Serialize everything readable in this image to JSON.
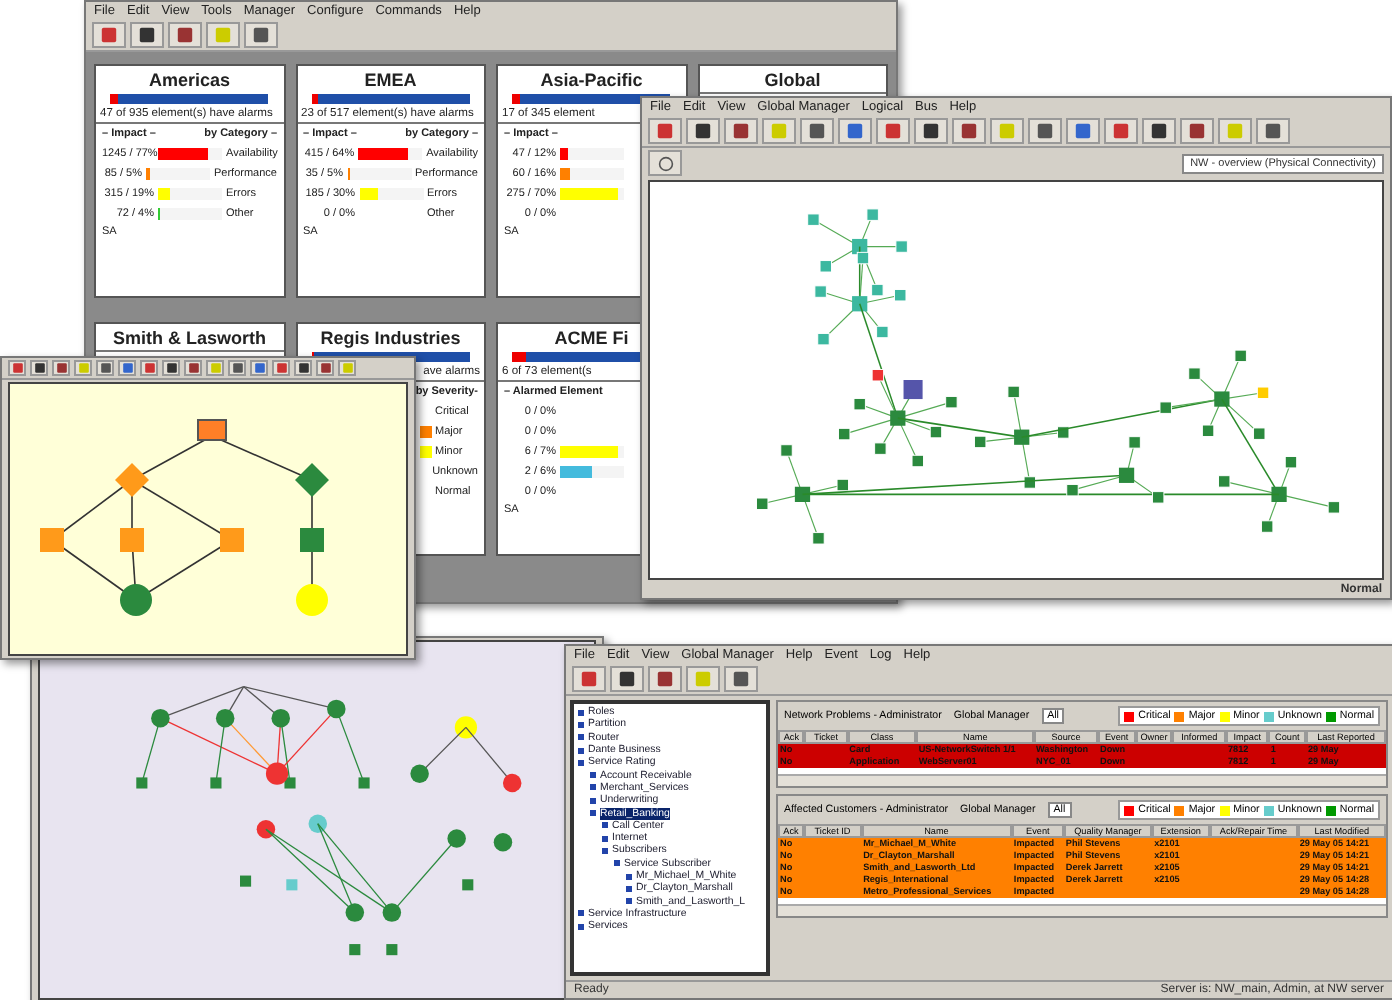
{
  "dashboard_window": {
    "menu": [
      "File",
      "Edit",
      "View",
      "Tools",
      "Manager",
      "Configure",
      "Commands",
      "Help"
    ],
    "cards": [
      {
        "title": "Americas",
        "alarm_bar": {
          "level": 0.05
        },
        "alarm_text": "47 of 935 element(s) have alarms",
        "headers": [
          "– Impact –",
          "by Category –"
        ],
        "rows": [
          {
            "value": "1245 / 77%",
            "level": 0.77,
            "color": "#ff0000",
            "label": "Availability"
          },
          {
            "value": "85 / 5%",
            "level": 0.05,
            "color": "#ff8000",
            "label": "Performance"
          },
          {
            "value": "315 / 19%",
            "level": 0.19,
            "color": "#ffff00",
            "label": "Errors"
          },
          {
            "value": "72 / 4%",
            "level": 0.04,
            "color": "#33cc33",
            "label": "Other"
          }
        ],
        "footer": "SA"
      },
      {
        "title": "EMEA",
        "alarm_bar": {
          "level": 0.04
        },
        "alarm_text": "23 of 517 element(s) have alarms",
        "headers": [
          "– Impact –",
          "by Category –"
        ],
        "rows": [
          {
            "value": "415 / 64%",
            "level": 0.77,
            "color": "#ff0000",
            "label": "Availability"
          },
          {
            "value": "35 / 5%",
            "level": 0.05,
            "color": "#ff8000",
            "label": "Performance"
          },
          {
            "value": "185 / 30%",
            "level": 0.3,
            "color": "#ffff00",
            "label": "Errors"
          },
          {
            "value": "0 / 0%",
            "label": "Other"
          }
        ],
        "footer": "SA"
      },
      {
        "title": "Asia-Pacific",
        "alarm_bar": {
          "level": 0.05
        },
        "alarm_text": "17 of 345 element",
        "headers": [
          "– Impact –"
        ],
        "rows": [
          {
            "value": "47 / 12%",
            "level": 0.12,
            "color": "#ff0000"
          },
          {
            "value": "60 / 16%",
            "level": 0.16,
            "color": "#ff8000"
          },
          {
            "value": "275 / 70%",
            "level": 0.9,
            "color": "#ffff00"
          },
          {
            "value": "0 / 0%"
          }
        ],
        "footer": "SA"
      },
      {
        "title": "Global"
      },
      {
        "title": "Smith & Lasworth"
      },
      {
        "title": "Regis Industries",
        "alarm_bar": {
          "level": 0
        },
        "alarm_text": "ave alarms",
        "headers": [
          "by Severity-"
        ],
        "rows": [
          {
            "label": "Critical"
          },
          {
            "label": "Major",
            "color": "#ff8000"
          },
          {
            "label": "Minor",
            "color": "#ffff00"
          },
          {
            "label": "Unknown"
          },
          {
            "label": "Normal"
          }
        ]
      },
      {
        "title": "ACME Fi",
        "alarm_bar": {
          "level": 0.08
        },
        "alarm_text": "6 of 73 element(s",
        "headers": [
          "– Alarmed Element"
        ],
        "rows": [
          {
            "value": "0 / 0%"
          },
          {
            "value": "0 / 0%"
          },
          {
            "value": "6 / 7%",
            "level": 0.9,
            "color": "#ffff00"
          },
          {
            "value": "2 / 6%",
            "level": 0.5,
            "color": "#44bbdd"
          },
          {
            "value": "0 / 0%"
          }
        ],
        "footer": "SA"
      }
    ]
  },
  "network_window": {
    "menu": [
      "File",
      "Edit",
      "View",
      "Global Manager",
      "Logical",
      "Bus",
      "Help"
    ],
    "view_select": "NW - overview (Physical Connectivity)",
    "status": "Normal"
  },
  "customer_window": {
    "menu": [
      "File",
      "Edit",
      "View",
      "Global Manager",
      "Help",
      "Event",
      "Log",
      "Help"
    ],
    "tree": [
      {
        "label": "Roles"
      },
      {
        "label": "Partition"
      },
      {
        "label": "Router"
      },
      {
        "label": "Dante Business"
      },
      {
        "label": "Service Rating",
        "children": [
          {
            "label": "Account Receivable"
          },
          {
            "label": "Merchant_Services"
          },
          {
            "label": "Underwriting"
          },
          {
            "label": "Retail_Banking",
            "selected": true,
            "children": [
              {
                "label": "Call Center"
              },
              {
                "label": "Internet"
              },
              {
                "label": "Subscribers",
                "children": [
                  {
                    "label": "Service Subscriber",
                    "children": [
                      {
                        "label": "Mr_Michael_M_White"
                      },
                      {
                        "label": "Dr_Clayton_Marshall"
                      },
                      {
                        "label": "Smith_and_Lasworth_L"
                      }
                    ]
                  }
                ]
              }
            ]
          }
        ]
      },
      {
        "label": "Service Infrastructure"
      },
      {
        "label": "Services"
      }
    ],
    "tables": [
      {
        "title": "Network Problems - Administrator",
        "manager_label": "Global Manager",
        "manager_value": "All",
        "legend": [
          {
            "label": "Critical",
            "color": "#ff0000"
          },
          {
            "label": "Major",
            "color": "#ff8000"
          },
          {
            "label": "Minor",
            "color": "#ffff00"
          },
          {
            "label": "Unknown",
            "color": "#66cccc"
          },
          {
            "label": "Normal",
            "color": "#009900"
          }
        ],
        "columns": [
          "Ack",
          "Ticket",
          "Class",
          "Name",
          "Source",
          "Event",
          "Owner",
          "Informed",
          "Impact",
          "Count",
          "Last Reported"
        ],
        "rows": [
          {
            "color": "#cc0000",
            "cells": [
              "No",
              "",
              "Card",
              "US-NetworkSwitch 1/1",
              "Washington",
              "Down",
              "",
              "",
              "7812",
              "1",
              "29 May"
            ]
          },
          {
            "color": "#cc0000",
            "cells": [
              "No",
              "",
              "Application",
              "WebServer01",
              "NYC_01",
              "Down",
              "",
              "",
              "7812",
              "1",
              "29 May"
            ]
          }
        ]
      },
      {
        "title": "Affected Customers - Administrator",
        "manager_label": "Global Manager",
        "manager_value": "All",
        "legend": [
          {
            "label": "Critical",
            "color": "#ff0000"
          },
          {
            "label": "Major",
            "color": "#ff8000"
          },
          {
            "label": "Minor",
            "color": "#ffff00"
          },
          {
            "label": "Unknown",
            "color": "#66cccc"
          },
          {
            "label": "Normal",
            "color": "#009900"
          }
        ],
        "columns": [
          "Ack",
          "Ticket ID",
          "Name",
          "Event",
          "Quality Manager",
          "Extension",
          "Ack/Repair Time",
          "Last Modified"
        ],
        "rows": [
          {
            "color": "#ff8000",
            "cells": [
              "No",
              "",
              "Mr_Michael_M_White",
              "Impacted",
              "Phil Stevens",
              "x2101",
              "",
              "29 May 05 14:21"
            ]
          },
          {
            "color": "#ff8000",
            "cells": [
              "No",
              "",
              "Dr_Clayton_Marshall",
              "Impacted",
              "Phil Stevens",
              "x2101",
              "",
              "29 May 05 14:21"
            ]
          },
          {
            "color": "#ff8000",
            "cells": [
              "No",
              "",
              "Smith_and_Lasworth_Ltd",
              "Impacted",
              "Derek Jarrett",
              "x2105",
              "",
              "29 May 05 14:21"
            ]
          },
          {
            "color": "#ff8000",
            "cells": [
              "No",
              "",
              "Regis_International",
              "Impacted",
              "Derek Jarrett",
              "x2105",
              "",
              "29 May 05 14:28"
            ]
          },
          {
            "color": "#ff8000",
            "cells": [
              "No",
              "",
              "Metro_Professional_Services",
              "Impacted",
              "",
              "",
              "",
              "29 May 05 14:28"
            ]
          }
        ]
      }
    ],
    "status_left": "Ready",
    "status_right": "Server is: NW_main, Admin, at NW server"
  }
}
